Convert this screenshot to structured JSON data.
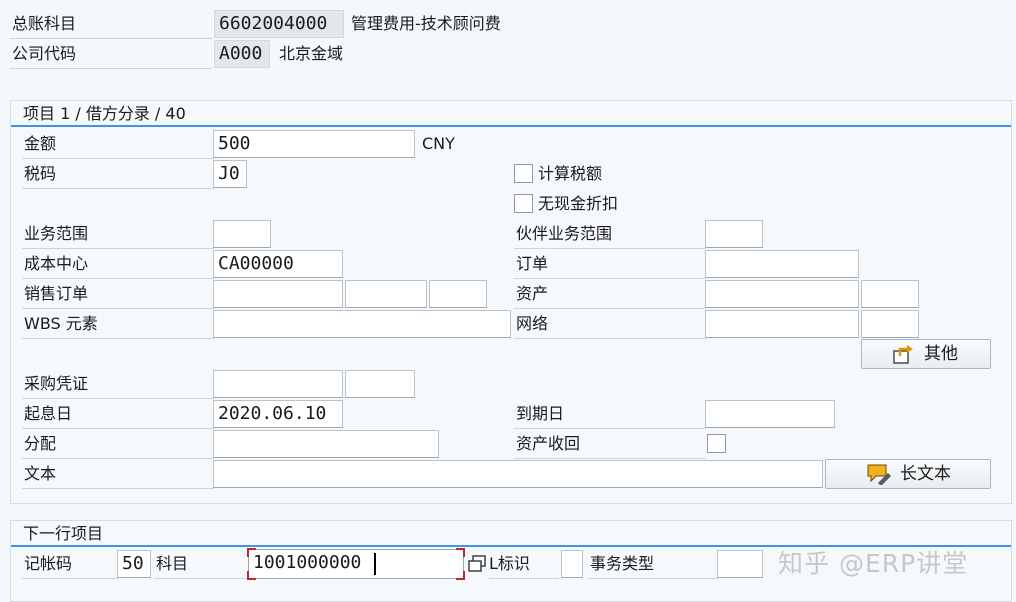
{
  "header": {
    "gl_account_label": "总账科目",
    "gl_account_value": "6602004000",
    "gl_account_desc": "管理费用-技术顾问费",
    "company_code_label": "公司代码",
    "company_code_value": "A000",
    "company_code_desc": "北京金域"
  },
  "item": {
    "title": "项目 1 / 借方分录 / 40",
    "amount_label": "金额",
    "amount_value": "500",
    "currency": "CNY",
    "tax_code_label": "税码",
    "tax_code_value": "J0",
    "calc_tax_label": "计算税额",
    "no_cash_discount_label": "无现金折扣",
    "business_area_label": "业务范围",
    "partner_business_area_label": "伙伴业务范围",
    "cost_center_label": "成本中心",
    "cost_center_value": "CA00000",
    "order_label": "订单",
    "sales_order_label": "销售订单",
    "asset_label": "资产",
    "wbs_label": "WBS 元素",
    "network_label": "网络",
    "more_button": "其他",
    "purchase_doc_label": "采购凭证",
    "value_date_label": "起息日",
    "value_date_value": "2020.06.10",
    "due_date_label": "到期日",
    "assignment_label": "分配",
    "asset_retirement_label": "资产收回",
    "text_label": "文本",
    "long_text_button": "长文本"
  },
  "next_item": {
    "title": "下一行项目",
    "posting_key_label": "记帐码",
    "posting_key_value": "50",
    "account_label": "科目",
    "account_value": "1001000000",
    "sgl_label": "L标识",
    "transaction_type_label": "事务类型"
  },
  "watermark": "知乎 @ERP讲堂",
  "icons": {
    "more": "export-arrow-icon",
    "long_text": "speech-bubble-pen-icon",
    "matchcode": "value-help-icon"
  },
  "colors": {
    "accent": "#0a6ed1",
    "focus": "#c0272d"
  }
}
